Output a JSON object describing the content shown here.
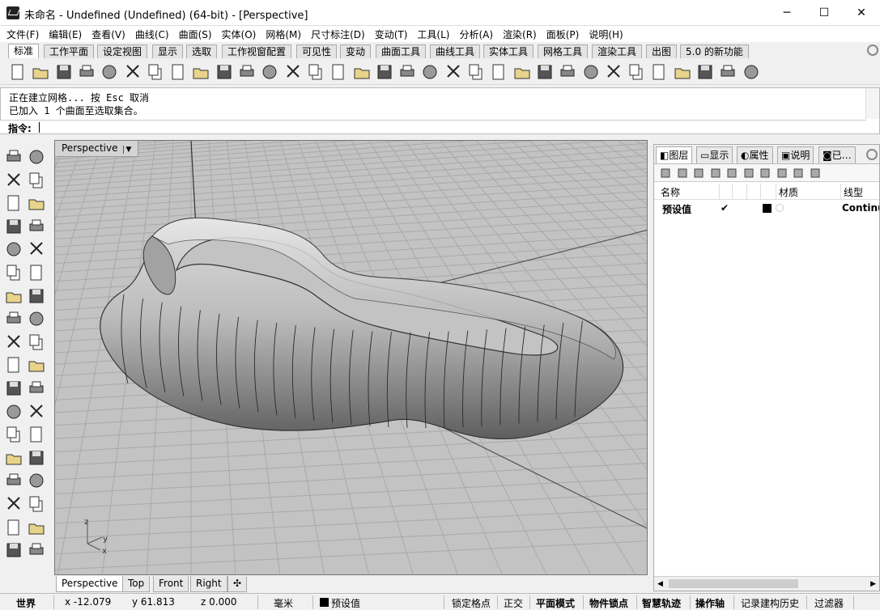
{
  "window": {
    "title": "未命名 - Undefined (Undefined) (64-bit) - [Perspective]",
    "minimize": "─",
    "maximize": "☐",
    "close": "✕"
  },
  "menu": [
    "文件(F)",
    "编辑(E)",
    "查看(V)",
    "曲线(C)",
    "曲面(S)",
    "实体(O)",
    "网格(M)",
    "尺寸标注(D)",
    "变动(T)",
    "工具(L)",
    "分析(A)",
    "渲染(R)",
    "面板(P)",
    "说明(H)"
  ],
  "toolbar_tabs": [
    "标准",
    "工作平面",
    "设定视图",
    "显示",
    "选取",
    "工作视窗配置",
    "可见性",
    "变动",
    "曲面工具",
    "曲线工具",
    "实体工具",
    "网格工具",
    "渲染工具",
    "出图",
    "5.0 的新功能"
  ],
  "toolbar_icons": [
    "new-file-icon",
    "open-folder-icon",
    "save-icon",
    "print-icon",
    "import-icon",
    "cut-icon",
    "copy-icon",
    "paste-icon",
    "undo-icon",
    "pan-hand-icon",
    "rotate-view-icon",
    "zoom-icon",
    "zoom-window-icon",
    "zoom-extents-icon",
    "zoom-selected-icon",
    "rotate-camera-icon",
    "four-viewports-icon",
    "car-icon",
    "properties-icon",
    "snap-point-icon",
    "select-filter-icon",
    "light-bulb-icon",
    "lock-icon",
    "layer-icon",
    "material-ball-icon",
    "render-sphere-icon",
    "shaded-sphere-icon",
    "rendered-sphere-icon",
    "dark-sphere-icon",
    "flag-icon",
    "gear-settings-icon",
    "grasshopper-icon",
    "help-icon"
  ],
  "command": {
    "history": [
      "正在建立网格... 按 Esc 取消",
      "已加入 1 个曲面至选取集合。"
    ],
    "prompt_label": "指令:"
  },
  "left_tool_icons": [
    "select-arrow-icon",
    "point-icon",
    "polyline-icon",
    "dimension-icon",
    "circle-icon",
    "ellipse-icon",
    "arc-icon",
    "rectangle-icon",
    "polygon-icon",
    "curve-icon",
    "surface-patch-icon",
    "surface-sweep-icon",
    "box-icon",
    "sphere-icon",
    "cylinder-icon",
    "mesh-icon",
    "explode-icon",
    "extend-icon",
    "trim-icon",
    "split-icon",
    "boolean-union-icon",
    "fillet-icon",
    "curve-offset-icon",
    "point-snap-icon",
    "text-icon",
    "scale-icon",
    "group-icon",
    "block-icon",
    "solid-icon",
    "array-up-icon",
    "grid-array-icon",
    "align-icon",
    "mirror-icon",
    "check-icon",
    "layout-icon",
    "edit-icon"
  ],
  "viewport": {
    "label": "Perspective",
    "dropdown": "▼",
    "axes": {
      "z": "z",
      "y": "y",
      "x": "x"
    }
  },
  "viewport_tabs": [
    "Perspective",
    "Top",
    "Front",
    "Right",
    "✣"
  ],
  "panel": {
    "tabs": [
      "图层",
      "显示",
      "属性",
      "说明",
      "已…"
    ],
    "columns": {
      "name": "名称",
      "material": "材质",
      "linetype": "线型"
    },
    "row": {
      "name": "预设值",
      "check": "✔",
      "linetype": "Continu"
    }
  },
  "status": {
    "world": "世界",
    "x": "x -12.079",
    "y": "y 61.813",
    "z": "z 0.000",
    "units": "毫米",
    "layer": "预设值",
    "grid_snap": "锁定格点",
    "ortho": "正交",
    "planar": "平面模式",
    "osnap": "物件锁点",
    "smart_track": "智慧轨迹",
    "gumball": "操作轴",
    "history": "记录建构历史",
    "filter": "过滤器"
  },
  "colors": {
    "viewport_bg": "#c3c3c3",
    "grid": "#a8a8a8",
    "model_light": "#dadada",
    "model_dark": "#6a6a6a"
  }
}
